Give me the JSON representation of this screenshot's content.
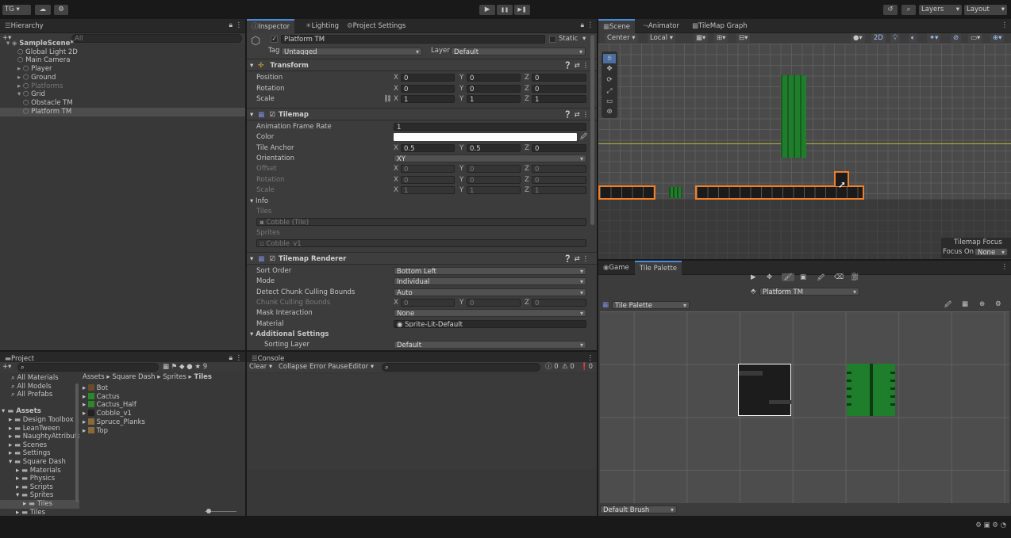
{
  "toolbar": {
    "account": "TG",
    "layers": "Layers",
    "layout": "Layout",
    "play": "▶",
    "pause": "❚❚",
    "step": "▶❚",
    "history_icon": "history-icon",
    "search_icon": "search-icon"
  },
  "hierarchy": {
    "tab": "Hierarchy",
    "search_placeholder": "All",
    "items": [
      {
        "label": "SampleScene*",
        "indent": 0
      },
      {
        "label": "Global Light 2D",
        "indent": 2
      },
      {
        "label": "Main Camera",
        "indent": 2
      },
      {
        "label": "Player",
        "indent": 2
      },
      {
        "label": "Ground",
        "indent": 2
      },
      {
        "label": "Platforms",
        "indent": 2
      },
      {
        "label": "Grid",
        "indent": 2
      },
      {
        "label": "Obstacle TM",
        "indent": 3
      },
      {
        "label": "Platform TM",
        "indent": 3
      }
    ]
  },
  "inspector": {
    "tabs": [
      "Inspector",
      "Lighting",
      "Project Settings"
    ],
    "object_name": "Platform TM",
    "static": "Static",
    "tag_label": "Tag",
    "tag": "Untagged",
    "layer_label": "Layer",
    "layer": "Default",
    "transform": {
      "title": "Transform",
      "rows": [
        {
          "label": "Position",
          "x": "0",
          "y": "0",
          "z": "0"
        },
        {
          "label": "Rotation",
          "x": "0",
          "y": "0",
          "z": "0"
        },
        {
          "label": "Scale",
          "x": "1",
          "y": "1",
          "z": "1"
        }
      ]
    },
    "tilemap": {
      "title": "Tilemap",
      "frame_rate_label": "Animation Frame Rate",
      "frame_rate": "1",
      "color_label": "Color",
      "anchor_label": "Tile Anchor",
      "anchor_x": "0.5",
      "anchor_y": "0.5",
      "anchor_z": "0",
      "orientation_label": "Orientation",
      "orientation": "XY",
      "offset_label": "Offset",
      "offset": [
        "0",
        "0",
        "0"
      ],
      "rotation_label": "Rotation",
      "rotation": [
        "0",
        "0",
        "0"
      ],
      "scale_label": "Scale",
      "scale": [
        "1",
        "1",
        "1"
      ],
      "info": "Info",
      "tiles_label": "Tiles",
      "tile": "Cobble (Tile)",
      "sprites_label": "Sprites",
      "sprite": "Cobble_v1"
    },
    "renderer": {
      "title": "Tilemap Renderer",
      "sort_order_label": "Sort Order",
      "sort_order": "Bottom Left",
      "mode_label": "Mode",
      "mode": "Individual",
      "culling_label": "Detect Chunk Culling Bounds",
      "culling": "Auto",
      "chunk_label": "Chunk Culling Bounds",
      "chunk": [
        "0",
        "0",
        "0"
      ],
      "mask_label": "Mask Interaction",
      "mask": "None",
      "material_label": "Material",
      "material": "Sprite-Lit-Default",
      "additional": "Additional Settings",
      "sorting_layer_label": "Sorting Layer",
      "sorting_layer": "Default"
    }
  },
  "scene": {
    "tabs": [
      "Scene",
      "Animator",
      "TileMap Graph"
    ],
    "pivot": "Center",
    "space": "Local",
    "mode_2d": "2D",
    "focus_title": "Tilemap Focus",
    "focus_label": "Focus On",
    "focus_value": "None"
  },
  "palette": {
    "tabs": [
      "Game",
      "Tile Palette"
    ],
    "target": "Platform TM",
    "palette": "Tile Palette",
    "brush": "Default Brush"
  },
  "project": {
    "tab": "Project",
    "count": "9",
    "favorites": [
      "All Materials",
      "All Models",
      "All Prefabs"
    ],
    "assets_root": "Assets",
    "tree": [
      {
        "label": "Design Toolbox",
        "d": 1
      },
      {
        "label": "LeanTween",
        "d": 1
      },
      {
        "label": "NaughtyAttribute",
        "d": 1
      },
      {
        "label": "Scenes",
        "d": 1
      },
      {
        "label": "Settings",
        "d": 1
      },
      {
        "label": "Square Dash",
        "d": 1
      },
      {
        "label": "Materials",
        "d": 2
      },
      {
        "label": "Physics",
        "d": 2
      },
      {
        "label": "Scripts",
        "d": 2
      },
      {
        "label": "Sprites",
        "d": 2
      },
      {
        "label": "Tiles",
        "d": 3
      },
      {
        "label": "Tiles",
        "d": 2
      }
    ],
    "breadcrumb": [
      "Assets",
      "Square Dash",
      "Sprites",
      "Tiles"
    ],
    "files": [
      {
        "label": "Bot",
        "color": "#6b4a2e"
      },
      {
        "label": "Cactus",
        "color": "#2a8a2a"
      },
      {
        "label": "Cactus_Half",
        "color": "#2a8a2a"
      },
      {
        "label": "Cobble_v1",
        "color": "#222"
      },
      {
        "label": "Spruce_Planks",
        "color": "#8a6a3a"
      },
      {
        "label": "Top",
        "color": "#8a6a3a"
      }
    ]
  },
  "console": {
    "tab": "Console",
    "clear": "Clear",
    "collapse": "Collapse",
    "error_pause": "Error Pause",
    "editor": "Editor",
    "c_log": "0",
    "c_warn": "0",
    "c_err": "0"
  }
}
